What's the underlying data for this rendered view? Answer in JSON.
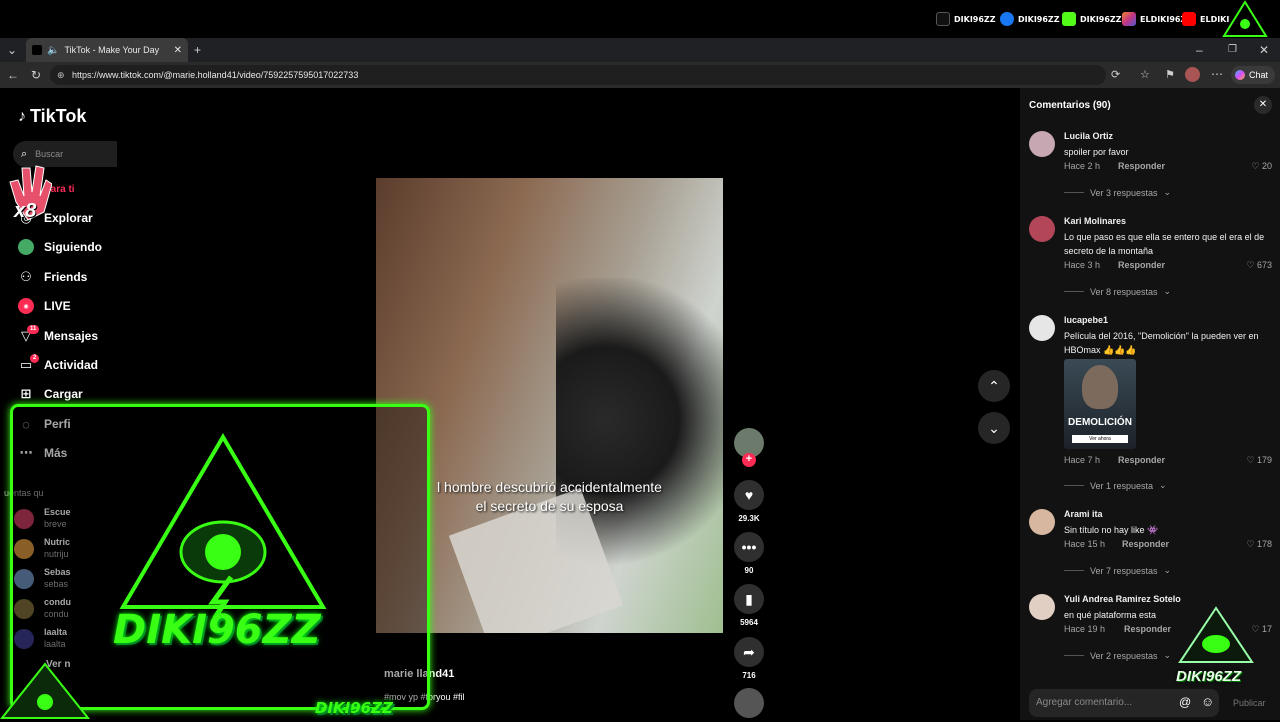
{
  "streamer": {
    "socials": [
      {
        "label": "DIKI96ZZ",
        "icon": "tiktok-icon",
        "color": "#111111"
      },
      {
        "label": "DIKI96ZZ",
        "icon": "facebook-icon",
        "color": "#1877f2"
      },
      {
        "label": "DIKI96ZZ",
        "icon": "kick-icon",
        "color": "#53fc18"
      },
      {
        "label": "ELDIKI96ZZ",
        "icon": "instagram-icon",
        "color": "#c13584"
      },
      {
        "label": "ELDIKI",
        "icon": "youtube-icon",
        "color": "#ff0000"
      }
    ],
    "overlay_logo": "DIKI96ZZ",
    "overlay_caption": "DIKI96ZZ",
    "watermark": "DIKI96ZZ",
    "accent": "#39ff14"
  },
  "browser": {
    "tab_title": "TikTok - Make Your Day",
    "url": "https://www.tiktok.com/@marie.holland41/video/7592257595017022733",
    "chat_label": "Chat"
  },
  "tiktok": {
    "brand": "TikTok",
    "search_placeholder": "Buscar",
    "nav": [
      {
        "label": "Para ti",
        "icon": "home-icon"
      },
      {
        "label": "Explorar",
        "icon": "compass-icon"
      },
      {
        "label": "Siguiendo",
        "icon": "following-icon"
      },
      {
        "label": "Friends",
        "icon": "friends-icon"
      },
      {
        "label": "LIVE",
        "icon": "live-icon"
      },
      {
        "label": "Mensajes",
        "icon": "messages-icon",
        "badge": "11"
      },
      {
        "label": "Actividad",
        "icon": "activity-icon",
        "badge": "2"
      },
      {
        "label": "Cargar",
        "icon": "upload-icon"
      },
      {
        "label": "Perfi",
        "icon": "profile-icon"
      },
      {
        "label": "Más",
        "icon": "more-icon"
      }
    ],
    "suggested_title": "uentas qu",
    "suggested": [
      {
        "name": "Escue",
        "sub": "breve"
      },
      {
        "name": "Nutric",
        "sub": "nutriju"
      },
      {
        "name": "Sebas",
        "sub": "sebas"
      },
      {
        "name": "condu",
        "sub": "condu"
      },
      {
        "name": "laalta",
        "sub": "laalta"
      }
    ],
    "see_more": "Ver n",
    "video": {
      "subtitle_line1": "l hombre descubrió accidentalmente",
      "subtitle_line2": "el secreto de su esposa",
      "author": "marie.holland41",
      "author_visible": "marie  lland41",
      "hashtags": "#mov      yp #foryou #fil"
    },
    "actions": {
      "likes": "29.3K",
      "comments": "90",
      "saves": "5964",
      "shares": "716"
    }
  },
  "comments_panel": {
    "title": "Comentarios (90)",
    "input_placeholder": "Agregar comentario...",
    "post_label": "Publicar",
    "reply_label": "Responder",
    "items": [
      {
        "user": "Lucila Ortiz",
        "text": "spoiler por favor",
        "time": "Hace 2 h",
        "likes": "20",
        "replies": "Ver 3 respuestas",
        "avatar_color": "#c7a7b2"
      },
      {
        "user": "Kari Molinares",
        "text": "Lo que paso es que ella se entero que el era el de secreto de la montaña",
        "time": "Hace 3 h",
        "likes": "673",
        "replies": "Ver 8 respuestas",
        "avatar_color": "#b4465a"
      },
      {
        "user": "lucapebe1",
        "text": "Película del 2016, \"Demolición\" la pueden ver en HBOmax 👍👍👍",
        "time": "Hace 7 h",
        "likes": "179",
        "replies": "Ver 1 respuesta",
        "avatar_color": "#e6e6e6",
        "poster_title": "DEMOLICIÓN",
        "poster_button": "Ver ahora"
      },
      {
        "user": "Arami ita",
        "text": "Sin título no hay like 👾",
        "time": "Hace 15 h",
        "likes": "178",
        "replies": "Ver 7 respuestas",
        "avatar_color": "#d8b7a0"
      },
      {
        "user": "Yuli Andrea Ramirez Sotelo",
        "text": "en qué plataforma esta",
        "time": "Hace 19 h",
        "likes": "17",
        "replies": "Ver 2 respuestas",
        "avatar_color": "#e2cfc4"
      }
    ]
  }
}
